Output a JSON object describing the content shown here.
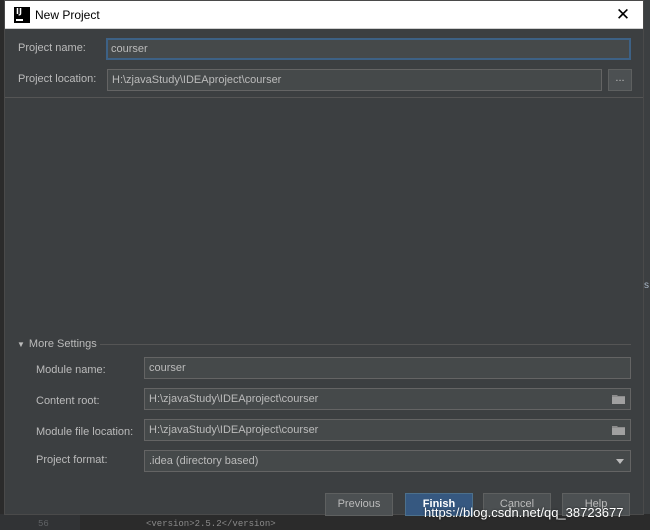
{
  "window": {
    "title": "New Project"
  },
  "form": {
    "project_name_label": "Project name:",
    "project_name_value": "courser",
    "project_location_label": "Project location:",
    "project_location_value": "H:\\zjavaStudy\\IDEAproject\\courser",
    "browse_label": "..."
  },
  "more_settings": {
    "header": "More Settings",
    "module_name_label": "Module name:",
    "module_name_value": "courser",
    "content_root_label": "Content root:",
    "content_root_value": "H:\\zjavaStudy\\IDEAproject\\courser",
    "module_file_location_label": "Module file location:",
    "module_file_location_value": "H:\\zjavaStudy\\IDEAproject\\courser",
    "project_format_label": "Project format:",
    "project_format_value": ".idea (directory based)"
  },
  "buttons": {
    "previous": "Previous",
    "finish": "Finish",
    "cancel": "Cancel",
    "help": "Help"
  },
  "background": {
    "line_number": "56",
    "code_text": "<version>2.5.2</version>",
    "right_glyph": "s"
  },
  "watermark": "https://blog.csdn.net/qq_38723677",
  "colors": {
    "dialog_bg": "#3c3f41",
    "field_bg": "#45494a",
    "focus_border": "#3d6185",
    "primary_button": "#365880",
    "text": "#bbbbbb"
  }
}
